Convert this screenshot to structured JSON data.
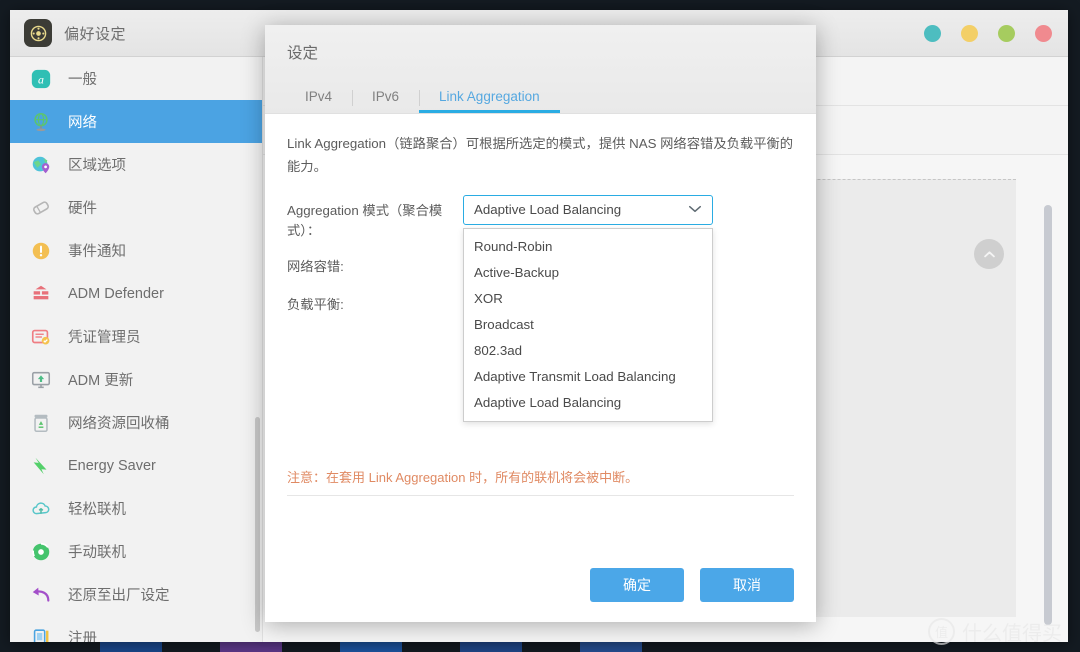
{
  "window": {
    "title": "偏好设定",
    "app_icon": "settings-gear-icon",
    "controls": [
      {
        "name": "hide-button",
        "color": "#4dbdc0"
      },
      {
        "name": "minimize-button",
        "color": "#f3cf67"
      },
      {
        "name": "maximize-button",
        "color": "#a6cc5f"
      },
      {
        "name": "close-button",
        "color": "#f08a8f"
      }
    ]
  },
  "sidebar": {
    "items": [
      {
        "label": "一般",
        "icon": "general-icon",
        "active": false
      },
      {
        "label": "网络",
        "icon": "network-globe-icon",
        "active": true
      },
      {
        "label": "区域选项",
        "icon": "region-pin-icon",
        "active": false
      },
      {
        "label": "硬件",
        "icon": "hardware-icon",
        "active": false
      },
      {
        "label": "事件通知",
        "icon": "alert-bell-icon",
        "active": false
      },
      {
        "label": "ADM Defender",
        "icon": "firewall-icon",
        "active": false
      },
      {
        "label": "凭证管理员",
        "icon": "certificate-icon",
        "active": false
      },
      {
        "label": "ADM 更新",
        "icon": "update-monitor-icon",
        "active": false
      },
      {
        "label": "网络资源回收桶",
        "icon": "recycle-bin-icon",
        "active": false
      },
      {
        "label": "Energy Saver",
        "icon": "energy-bolt-icon",
        "active": false
      },
      {
        "label": "轻松联机",
        "icon": "cloud-connect-icon",
        "active": false
      },
      {
        "label": "手动联机",
        "icon": "manual-connect-icon",
        "active": false
      },
      {
        "label": "还原至出厂设定",
        "icon": "restore-arrow-icon",
        "active": false
      },
      {
        "label": "注册",
        "icon": "register-icon",
        "active": false
      }
    ]
  },
  "content": {
    "collapse_icon": "chevron-up-icon",
    "scrollbar": "vertical-scrollbar"
  },
  "dialog": {
    "title": "设定",
    "tabs": [
      {
        "label": "IPv4",
        "active": false
      },
      {
        "label": "IPv6",
        "active": false
      },
      {
        "label": "Link Aggregation",
        "active": true
      }
    ],
    "description": "Link Aggregation（链路聚合）可根据所选定的模式，提供 NAS 网络容错及负载平衡的能力。",
    "mode_label": "Aggregation 模式（聚合模式）：",
    "fault_tolerance_label": "网络容错:",
    "load_balance_label": "负载平衡:",
    "select": {
      "value": "Adaptive Load Balancing",
      "arrow_icon": "chevron-down-icon",
      "options": [
        "Round-Robin",
        "Active-Backup",
        "XOR",
        "Broadcast",
        "802.3ad",
        "Adaptive Transmit Load Balancing",
        "Adaptive Load Balancing"
      ]
    },
    "note": "注意：在套用 Link Aggregation 时，所有的联机将会被中断。",
    "note_color": "#e08a63",
    "buttons": {
      "confirm": "确定",
      "cancel": "取消",
      "color": "#4ba7e8"
    }
  },
  "watermark": {
    "badge": "值",
    "text": "什么值得买"
  }
}
